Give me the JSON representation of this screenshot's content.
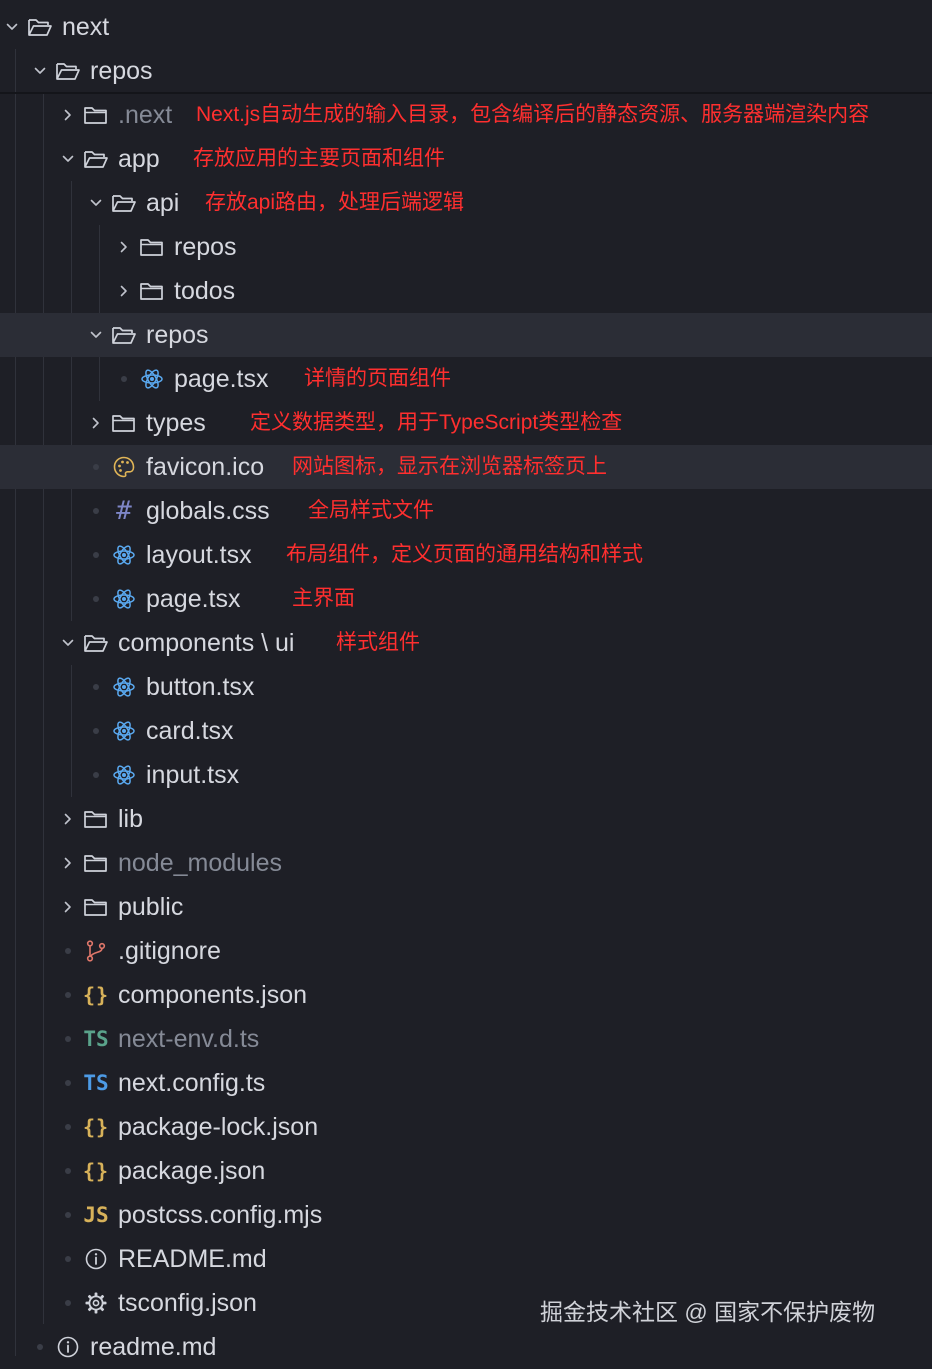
{
  "explorer": {
    "items": [
      {
        "label": "next",
        "depth": 0,
        "kind": "folder",
        "expanded": true
      },
      {
        "label": "repos",
        "depth": 1,
        "kind": "folder",
        "expanded": true
      },
      {
        "label": ".next",
        "depth": 2,
        "kind": "folder",
        "expanded": false,
        "dim": true,
        "note": "Next.js自动生成的输入目录，包含编译后的静态资源、服务器端渲染内容"
      },
      {
        "label": "app",
        "depth": 2,
        "kind": "folder",
        "expanded": true,
        "note": "存放应用的主要页面和组件"
      },
      {
        "label": "api",
        "depth": 3,
        "kind": "folder",
        "expanded": true,
        "note": "存放api路由，处理后端逻辑"
      },
      {
        "label": "repos",
        "depth": 4,
        "kind": "folder",
        "expanded": false
      },
      {
        "label": "todos",
        "depth": 4,
        "kind": "folder",
        "expanded": false
      },
      {
        "label": "repos",
        "depth": 3,
        "kind": "folder",
        "expanded": true,
        "selected": true
      },
      {
        "label": "page.tsx",
        "depth": 4,
        "kind": "file",
        "icon": "react-icon",
        "note": "详情的页面组件"
      },
      {
        "label": "types",
        "depth": 3,
        "kind": "folder",
        "expanded": false,
        "note": "定义数据类型，用于TypeScript类型检查"
      },
      {
        "label": "favicon.ico",
        "depth": 3,
        "kind": "file",
        "icon": "palette-icon",
        "selected": true,
        "note": "网站图标，显示在浏览器标签页上"
      },
      {
        "label": "globals.css",
        "depth": 3,
        "kind": "file",
        "icon": "hash-icon",
        "note": "全局样式文件"
      },
      {
        "label": "layout.tsx",
        "depth": 3,
        "kind": "file",
        "icon": "react-icon",
        "note": "布局组件，定义页面的通用结构和样式"
      },
      {
        "label": "page.tsx",
        "depth": 3,
        "kind": "file",
        "icon": "react-icon",
        "note": "主界面"
      },
      {
        "label": "components \\ ui",
        "depth": 2,
        "kind": "folder",
        "expanded": true,
        "note": "样式组件"
      },
      {
        "label": "button.tsx",
        "depth": 3,
        "kind": "file",
        "icon": "react-icon"
      },
      {
        "label": "card.tsx",
        "depth": 3,
        "kind": "file",
        "icon": "react-icon"
      },
      {
        "label": "input.tsx",
        "depth": 3,
        "kind": "file",
        "icon": "react-icon"
      },
      {
        "label": "lib",
        "depth": 2,
        "kind": "folder",
        "expanded": false
      },
      {
        "label": "node_modules",
        "depth": 2,
        "kind": "folder",
        "expanded": false,
        "dim": true
      },
      {
        "label": "public",
        "depth": 2,
        "kind": "folder",
        "expanded": false
      },
      {
        "label": ".gitignore",
        "depth": 2,
        "kind": "file",
        "icon": "git-branch-icon"
      },
      {
        "label": "components.json",
        "depth": 2,
        "kind": "file",
        "icon": "json-icon"
      },
      {
        "label": "next-env.d.ts",
        "depth": 2,
        "kind": "file",
        "icon": "ts-icon",
        "dim": true
      },
      {
        "label": "next.config.ts",
        "depth": 2,
        "kind": "file",
        "icon": "ts-icon"
      },
      {
        "label": "package-lock.json",
        "depth": 2,
        "kind": "file",
        "icon": "json-icon"
      },
      {
        "label": "package.json",
        "depth": 2,
        "kind": "file",
        "icon": "json-icon"
      },
      {
        "label": "postcss.config.mjs",
        "depth": 2,
        "kind": "file",
        "icon": "js-icon"
      },
      {
        "label": "README.md",
        "depth": 2,
        "kind": "file",
        "icon": "info-icon"
      },
      {
        "label": "tsconfig.json",
        "depth": 2,
        "kind": "file",
        "icon": "gear-icon"
      },
      {
        "label": "readme.md",
        "depth": 1,
        "kind": "file",
        "icon": "info-icon"
      }
    ]
  },
  "icon_text": {
    "ts": "TS",
    "js": "JS",
    "json": "{}",
    "hash": "#"
  },
  "watermark": "掘金技术社区 @ 国家不保护废物",
  "colors": {
    "background": "#1e1f26",
    "selected_row": "#2b2d36",
    "annotation": "#ff2f2f",
    "text": "#d6d8df",
    "dim_text": "#858a96",
    "react_icon": "#5aa9f0",
    "ts_icon": "#4d9be6",
    "js_icon": "#d8b25a",
    "json_icon": "#d8b25a"
  }
}
